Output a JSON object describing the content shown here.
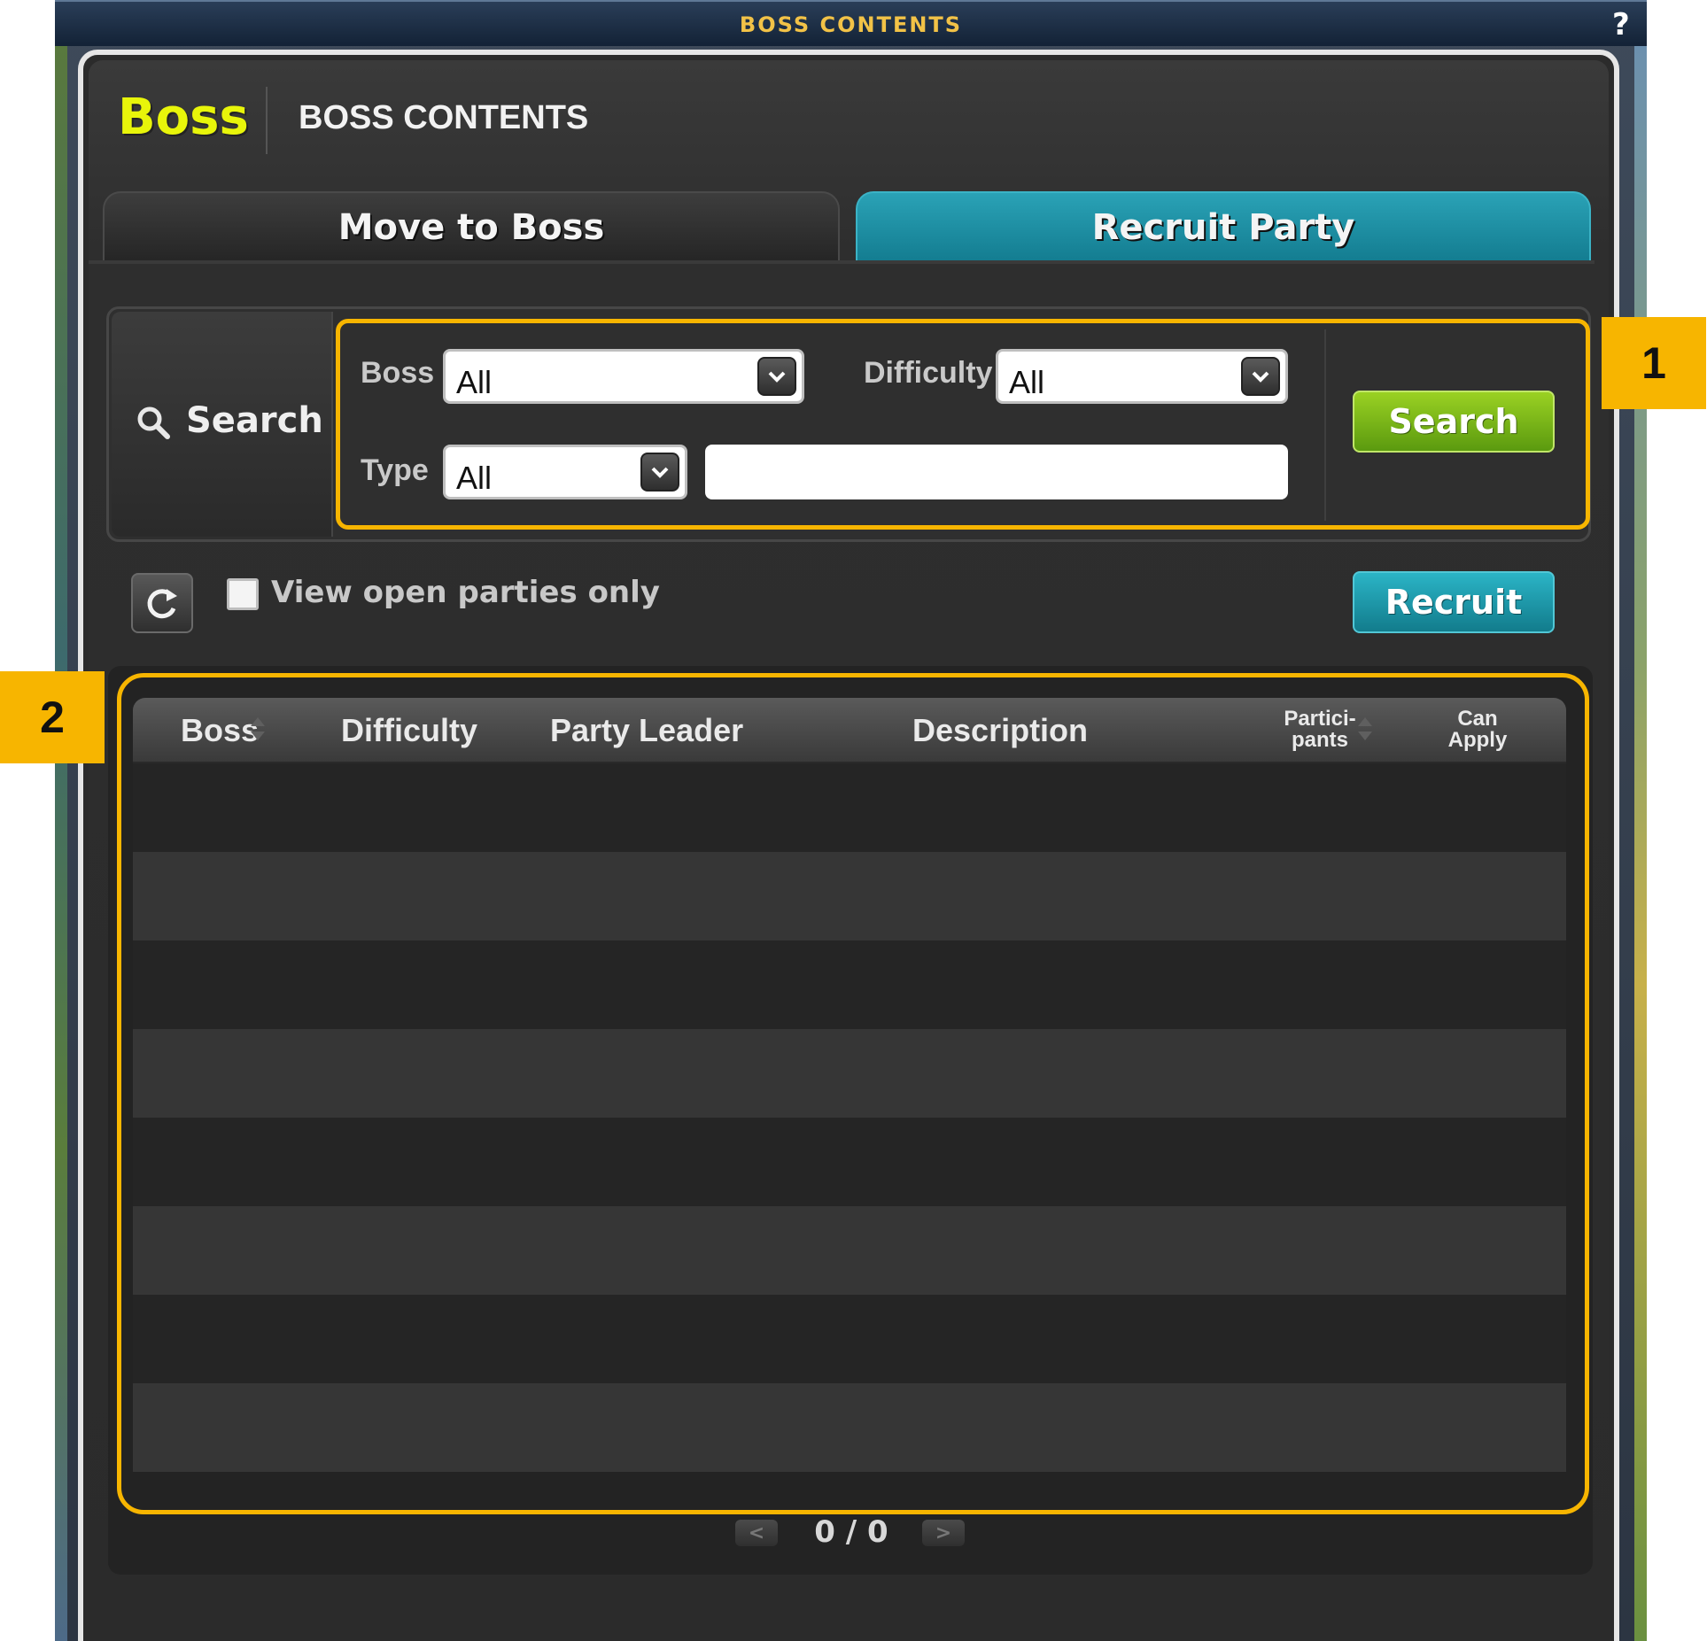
{
  "window": {
    "title": "BOSS CONTENTS",
    "help": "?",
    "close": "✕"
  },
  "header": {
    "logo": "Boss",
    "title": "BOSS CONTENTS"
  },
  "tabs": [
    {
      "label": "Move to Boss",
      "active": false
    },
    {
      "label": "Recruit Party",
      "active": true
    }
  ],
  "search": {
    "section_label": "Search",
    "boss_label": "Boss",
    "boss_value": "All",
    "difficulty_label": "Difficulty",
    "difficulty_value": "All",
    "type_label": "Type",
    "type_value": "All",
    "text_value": "",
    "button_label": "Search"
  },
  "options": {
    "open_only_label": "View open parties only",
    "open_only_checked": false,
    "recruit_label": "Recruit"
  },
  "table": {
    "columns": [
      "Boss",
      "Difficulty",
      "Party Leader",
      "Description",
      "Partici-\npants",
      "Can\nApply"
    ],
    "rows": []
  },
  "pager": {
    "text": "0 / 0",
    "prev": "<",
    "next": ">"
  },
  "callouts": [
    "1",
    "2"
  ],
  "colors": {
    "accent_teal": "#1b8fa3",
    "accent_green": "#7dbb18",
    "logo_yellow": "#e8f50a",
    "callout": "#f7b500"
  }
}
